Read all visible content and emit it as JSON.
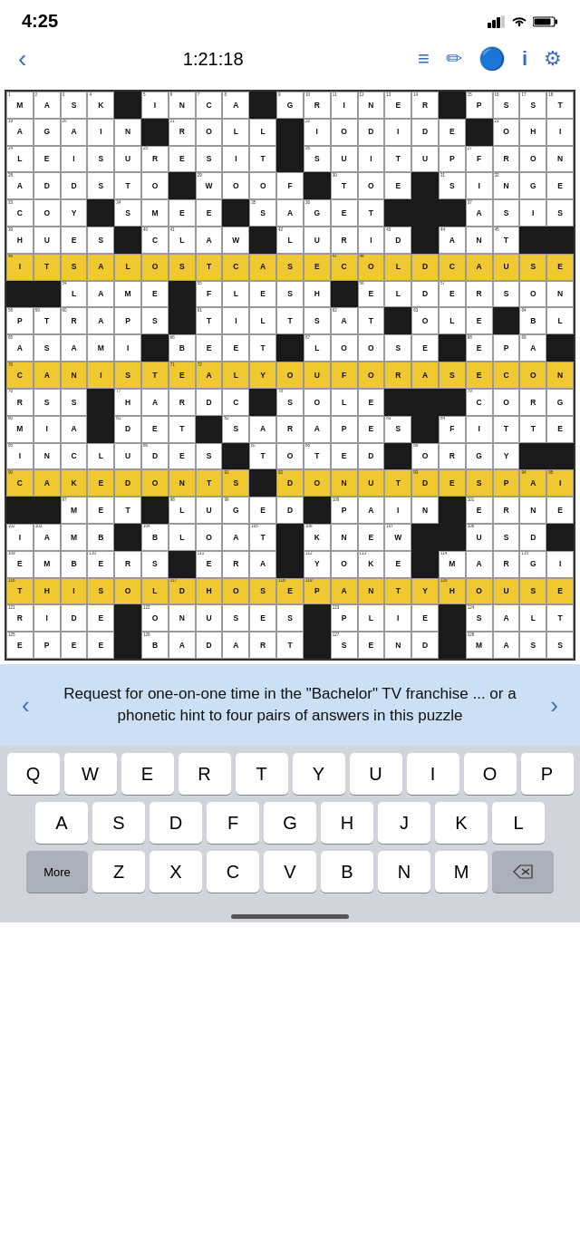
{
  "statusBar": {
    "time": "4:25"
  },
  "toolbar": {
    "timer": "1:21:18",
    "backIcon": "‹",
    "listIcon": "≡",
    "pencilIcon": "✏",
    "helpIcon": "⊙",
    "infoIcon": "i",
    "settingsIcon": "⚙"
  },
  "clue": {
    "text": "Request for one-on-one time in the \"Bachelor\" TV franchise ... or a phonetic hint to four pairs of answers in this puzzle"
  },
  "keyboard": {
    "row1": [
      "Q",
      "W",
      "E",
      "R",
      "T",
      "Y",
      "U",
      "I",
      "O",
      "P"
    ],
    "row2": [
      "A",
      "S",
      "D",
      "F",
      "G",
      "H",
      "J",
      "K",
      "L"
    ],
    "row3Left": "More",
    "row3": [
      "Z",
      "X",
      "C",
      "V",
      "B",
      "N",
      "M"
    ],
    "backspace": "⌫"
  },
  "grid": {
    "note": "21x21 crossword grid data encoded below"
  }
}
